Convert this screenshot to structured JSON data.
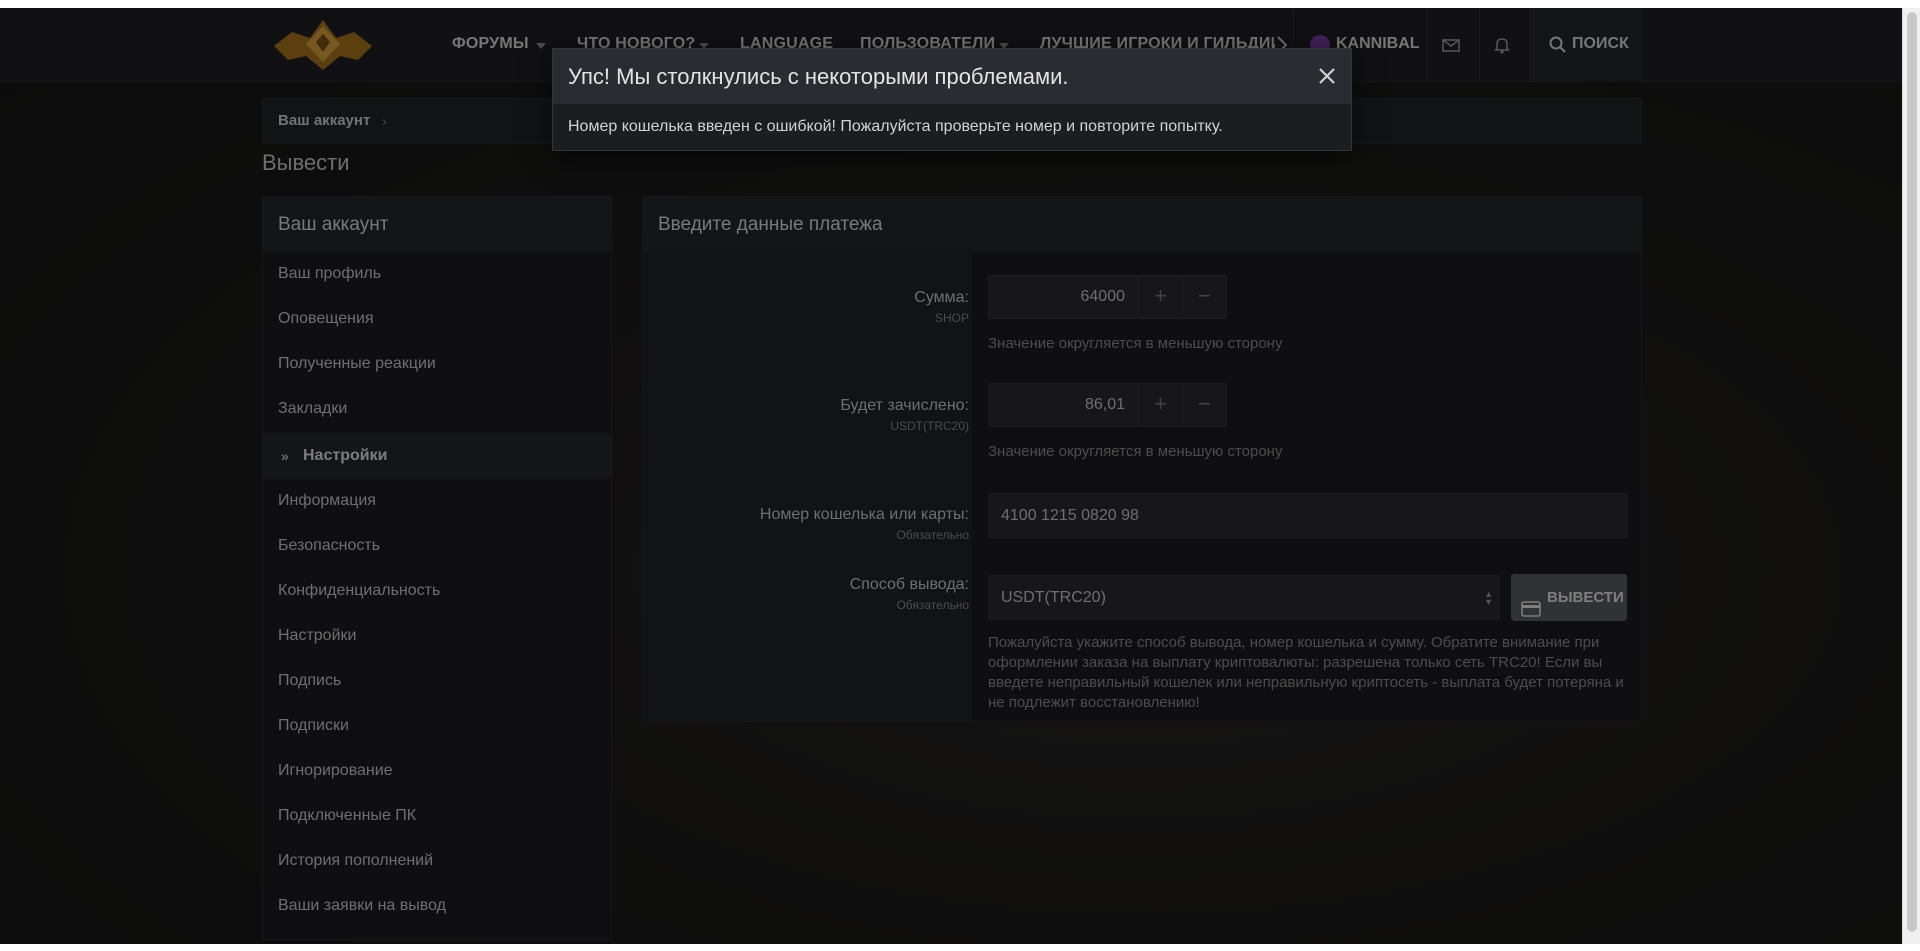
{
  "header": {
    "nav": [
      {
        "label": "ФОРУМЫ"
      },
      {
        "label": "ЧТО НОВОГО?"
      },
      {
        "label": "LANGUAGE"
      },
      {
        "label": "ПОЛЬЗОВАТЕЛИ"
      },
      {
        "label": "ЛУЧШИЕ ИГРОКИ И ГИЛЬДИИ"
      }
    ],
    "username": "KANNIBAL",
    "search_label": "ПОИСК"
  },
  "breadcrumb": {
    "link": "Ваш аккаунт",
    "separator": "›"
  },
  "page_title": "Вывести",
  "sidebar": {
    "title": "Ваш аккаунт",
    "items": [
      {
        "label": "Ваш профиль"
      },
      {
        "label": "Оповещения"
      },
      {
        "label": "Полученные реакции"
      },
      {
        "label": "Закладки"
      },
      {
        "label": "Настройки",
        "active": true
      },
      {
        "label": "Информация"
      },
      {
        "label": "Безопасность"
      },
      {
        "label": "Конфиденциальность"
      },
      {
        "label": "Настройки"
      },
      {
        "label": "Подпись"
      },
      {
        "label": "Подписки"
      },
      {
        "label": "Игнорирование"
      },
      {
        "label": "Подключенные ПК"
      },
      {
        "label": "История пополнений"
      },
      {
        "label": "Ваши заявки на вывод"
      }
    ],
    "active_marker": "»"
  },
  "form": {
    "title": "Введите данные платежа",
    "amount": {
      "label": "Сумма:",
      "sublabel": "SHOP",
      "value": "64000",
      "hint": "Значение округляется в меньшую сторону"
    },
    "credited": {
      "label": "Будет зачислено:",
      "sublabel": "USDT(TRC20)",
      "value": "86,01",
      "hint": "Значение округляется в меньшую сторону"
    },
    "wallet": {
      "label": "Номер кошелька или карты:",
      "sublabel": "Обязательно",
      "value": "4100 1215 0820 98"
    },
    "method": {
      "label": "Способ вывода:",
      "sublabel": "Обязательно",
      "selected": "USDT(TRC20)"
    },
    "submit_label": "ВЫВЕСТИ",
    "notice": "Пожалуйста укажите способ вывода, номер кошелька и сумму. Обратите внимание при оформлении заказа на выплату криптовалюты: разрешена только сеть TRC20! Если вы введете неправильный кошелек или неправильную криптосеть - выплата будет потеряна и не подлежит восстановлению!",
    "plus": "+",
    "minus": "−"
  },
  "modal": {
    "title": "Упс! Мы столкнулись с некоторыми проблемами.",
    "message": "Номер кошелька введен с ошибкой! Пожалуйста проверьте номер и повторите попытку."
  },
  "colors": {
    "header_bg": "#1f2024",
    "panel_bg": "#1c1d21",
    "button_bg": "#5a5b60",
    "avatar": "#7d3aa0"
  },
  "icons": [
    "logo",
    "chevron-down-icon",
    "chevron-right-icon",
    "mail-icon",
    "bell-icon",
    "search-icon",
    "credit-card-icon",
    "close-icon",
    "double-chevron-icon"
  ]
}
